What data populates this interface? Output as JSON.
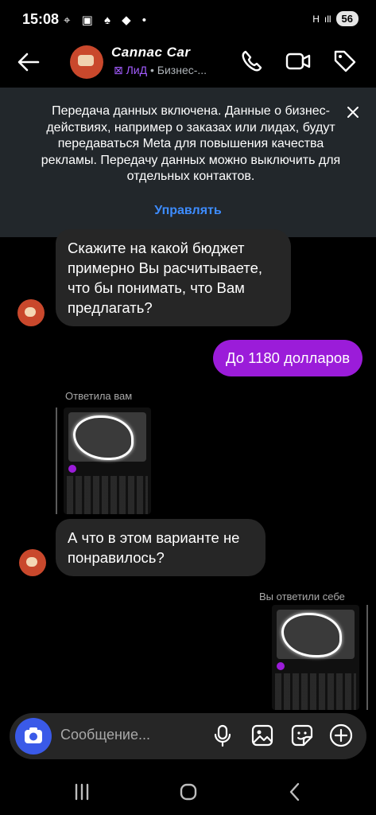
{
  "status_bar": {
    "time": "15:08",
    "notification_icons": "⌖ ▣ ♠ ◆ •",
    "network": "H",
    "signal": "ıll",
    "battery": "56"
  },
  "header": {
    "contact_name": "Cannac Car",
    "lead_badge": "⊠ ЛиД",
    "lead_sub": " • Бизнес-..."
  },
  "banner": {
    "text": "Передача данных включена. Данные о бизнес-действиях, например о заказах или лидах, будут передаваться Meta для повышения качества рекламы. Передачу данных можно выключить для отдельных контактов.",
    "link": "Управлять"
  },
  "messages": {
    "m1": "Скажите на какой бюджет примерно Вы расчитываете, что бы понимать, что Вам предлагать?",
    "m2": "До 1180 долларов",
    "caption1": "Ответила вам",
    "m3": "А что в этом варианте не понравилось?",
    "caption2": "Вы ответили себе"
  },
  "composer": {
    "placeholder": "Сообщение..."
  },
  "colors": {
    "outgoing_bubble": "#9b1cd9",
    "incoming_bubble": "#262626",
    "link": "#3d8cff",
    "camera_button": "#3a5ae8"
  }
}
